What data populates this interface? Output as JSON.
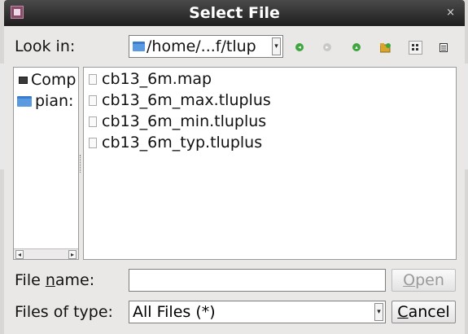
{
  "window": {
    "title": "Select File"
  },
  "lookin": {
    "label": "Look in:",
    "path": "/home/...f/tlup"
  },
  "toolbar": {
    "back": "back-icon",
    "forward": "forward-icon",
    "up": "up-icon",
    "new_folder": "new-folder-icon",
    "list_view": "list-view-icon",
    "detail_view": "detail-view-icon"
  },
  "places": [
    {
      "label": "Comp",
      "icon": "computer-icon"
    },
    {
      "label": "pian:",
      "icon": "home-folder-icon"
    }
  ],
  "files": [
    {
      "name": "cb13_6m.map"
    },
    {
      "name": "cb13_6m_max.tluplus"
    },
    {
      "name": "cb13_6m_min.tluplus"
    },
    {
      "name": "cb13_6m_typ.tluplus"
    }
  ],
  "filename": {
    "label_pre": "File ",
    "label_u": "n",
    "label_post": "ame:",
    "value": ""
  },
  "filetype": {
    "label": "Files of type:",
    "value": "All Files (*)"
  },
  "buttons": {
    "open_u": "O",
    "open_rest": "pen",
    "cancel_u": "C",
    "cancel_rest": "ancel"
  },
  "colors": {
    "titlebar": "#2b2b2b",
    "folder": "#5a9ae0",
    "background": "#e9e8e6"
  }
}
